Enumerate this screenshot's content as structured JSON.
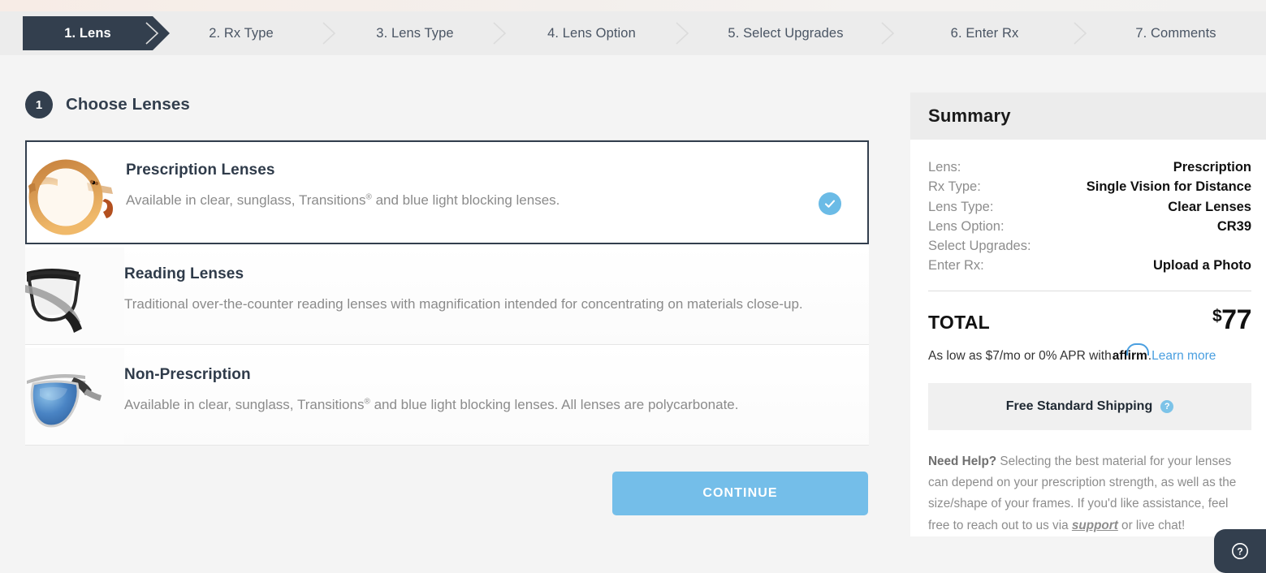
{
  "stepper": {
    "steps": [
      {
        "label": "1. Lens",
        "active": true
      },
      {
        "label": "2. Rx Type",
        "active": false
      },
      {
        "label": "3. Lens Type",
        "active": false
      },
      {
        "label": "4. Lens Option",
        "active": false
      },
      {
        "label": "5. Select Upgrades",
        "active": false
      },
      {
        "label": "6. Enter Rx",
        "active": false
      },
      {
        "label": "7. Comments",
        "active": false
      }
    ]
  },
  "section": {
    "number": "1",
    "title": "Choose Lenses"
  },
  "options": [
    {
      "title": "Prescription Lenses",
      "desc_before": "Available in clear, sunglass, Transitions",
      "desc_sup": "®",
      "desc_after": " and blue light blocking lenses.",
      "selected": true,
      "thumb": "amber-round-eyeglasses-image"
    },
    {
      "title": "Reading Lenses",
      "desc_before": "Traditional over-the-counter reading lenses with magnification intended for concentrating on materials close-up.",
      "desc_sup": "",
      "desc_after": "",
      "selected": false,
      "thumb": "black-reading-glasses-image"
    },
    {
      "title": "Non-Prescription",
      "desc_before": "Available in clear, sunglass, Transitions",
      "desc_sup": "®",
      "desc_after": " and blue light blocking lenses. All lenses are polycarbonate.",
      "selected": false,
      "thumb": "blue-aviator-sunglasses-image"
    }
  ],
  "actions": {
    "continue_label": "CONTINUE"
  },
  "summary": {
    "heading": "Summary",
    "rows": [
      {
        "label": "Lens:",
        "value": "Prescription"
      },
      {
        "label": "Rx Type:",
        "value": "Single Vision for Distance"
      },
      {
        "label": "Lens Type:",
        "value": "Clear Lenses"
      },
      {
        "label": "Lens Option:",
        "value": "CR39"
      },
      {
        "label": "Select Upgrades:",
        "value": ""
      },
      {
        "label": "Enter Rx:",
        "value": "Upload a Photo"
      }
    ],
    "total_label": "TOTAL",
    "total_currency": "$",
    "total_amount": "77",
    "financing_text": "As low as $7/mo or 0% APR with ",
    "financing_brand": "affirm",
    "financing_suffix": ". ",
    "learn_more": "Learn more",
    "shipping_label": "Free Standard Shipping",
    "shipping_tooltip_icon": "question-mark-icon",
    "help_title": "Need Help?",
    "help_text_1": " Selecting the best material for your lenses can depend on your prescription strength, as well as the size/shape of your frames. If you'd like assistance, feel free to reach out to us via ",
    "help_link": "support",
    "help_text_2": " or live chat!"
  },
  "chat": {
    "icon": "question-circle-icon",
    "label": "?"
  },
  "colors": {
    "accent_blue": "#74bee9",
    "dark_navy": "#333f4e",
    "link_blue": "#4a9fe0",
    "check_blue": "#6bbbe6"
  }
}
